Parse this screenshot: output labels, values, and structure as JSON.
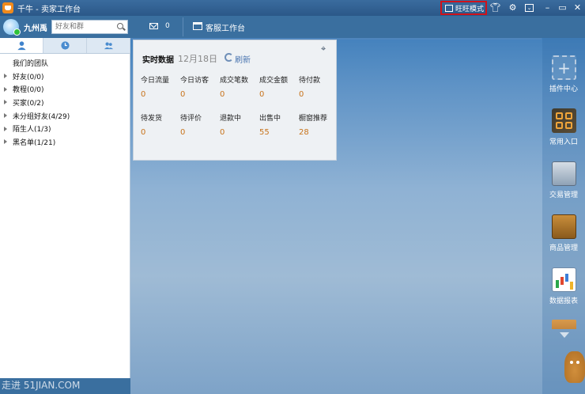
{
  "window": {
    "title": "千牛 - 卖家工作台",
    "mode_button_label": "旺旺模式"
  },
  "titlebar_icons": [
    "house-icon",
    "shirt-icon",
    "gear-icon",
    "mail-dropdown-icon",
    "minimize-icon",
    "maximize-icon",
    "close-icon"
  ],
  "sidebar": {
    "user_name": "九州禹",
    "search_placeholder": "好友和群",
    "tabs": [
      {
        "icon": "contacts-icon"
      },
      {
        "icon": "recent-clock-icon"
      },
      {
        "icon": "group-people-icon"
      }
    ],
    "groups": [
      {
        "label": "我们的团队"
      },
      {
        "label": "好友(0/0)"
      },
      {
        "label": "教程(0/0)"
      },
      {
        "label": "买家(0/2)"
      },
      {
        "label": "未分组好友(4/29)"
      },
      {
        "label": "陌生人(1/3)"
      },
      {
        "label": "黑名单(1/21)"
      }
    ],
    "watermark": "走进 51JIAN.COM"
  },
  "topbar": {
    "message_count": "0",
    "cs_workbench_label": "客服工作台"
  },
  "realtime": {
    "title": "实时数据",
    "date": "12月18日",
    "refresh_label": "刷新",
    "metrics": [
      {
        "label": "今日流量",
        "value": "0"
      },
      {
        "label": "今日访客",
        "value": "0"
      },
      {
        "label": "成交笔数",
        "value": "0"
      },
      {
        "label": "成交金额",
        "value": "0"
      },
      {
        "label": "待付款",
        "value": "0"
      },
      {
        "label": "待发货",
        "value": "0"
      },
      {
        "label": "待评价",
        "value": "0"
      },
      {
        "label": "退款中",
        "value": "0"
      },
      {
        "label": "出售中",
        "value": "55"
      },
      {
        "label": "橱窗推荐",
        "value": "28"
      }
    ]
  },
  "rail": {
    "items": [
      {
        "label": "插件中心",
        "icon": "plugin-add-icon"
      },
      {
        "label": "常用入口",
        "icon": "common-entry-icon"
      },
      {
        "label": "交易管理",
        "icon": "trade-management-icon"
      },
      {
        "label": "商品管理",
        "icon": "goods-management-icon"
      },
      {
        "label": "数据报表",
        "icon": "data-report-icon"
      }
    ]
  }
}
